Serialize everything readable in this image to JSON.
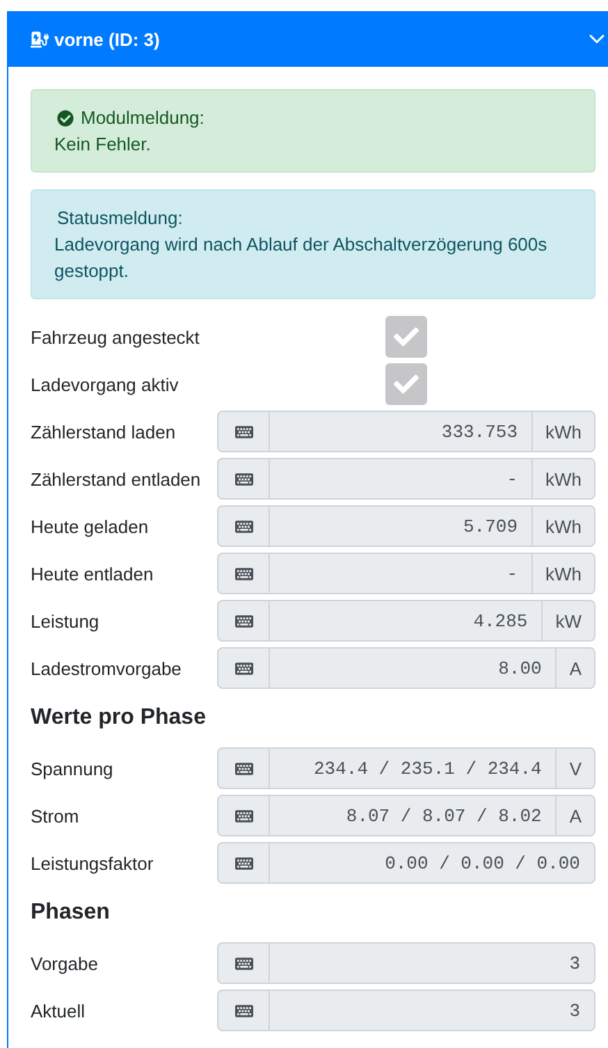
{
  "header": {
    "title": "vorne (ID: 3)",
    "expanded": true
  },
  "alerts": [
    {
      "kind": "success",
      "title": "Modulmeldung:",
      "text": "Kein Fehler."
    },
    {
      "kind": "info",
      "title": "Statusmeldung:",
      "text": "Ladevorgang wird nach Ablauf der Abschaltverzögerung 600s gestoppt."
    }
  ],
  "sections": [
    {
      "rows": [
        {
          "kind": "checkbox",
          "label": "Fahrzeug angesteckt",
          "checked": true
        },
        {
          "kind": "checkbox",
          "label": "Ladevorgang aktiv",
          "checked": true
        },
        {
          "kind": "readout",
          "label": "Zählerstand laden",
          "value": "333.753",
          "unit": "kWh"
        },
        {
          "kind": "readout",
          "label": "Zählerstand entladen",
          "value": "-",
          "unit": "kWh"
        },
        {
          "kind": "readout",
          "label": "Heute geladen",
          "value": "5.709",
          "unit": "kWh"
        },
        {
          "kind": "readout",
          "label": "Heute entladen",
          "value": "-",
          "unit": "kWh"
        },
        {
          "kind": "readout",
          "label": "Leistung",
          "value": "4.285",
          "unit": "kW"
        },
        {
          "kind": "readout",
          "label": "Ladestromvorgabe",
          "value": "8.00",
          "unit": "A"
        }
      ]
    },
    {
      "heading": "Werte pro Phase",
      "rows": [
        {
          "kind": "readout",
          "label": "Spannung",
          "value": "234.4 / 235.1 / 234.4",
          "unit": "V"
        },
        {
          "kind": "readout",
          "label": "Strom",
          "value": "8.07 / 8.07 / 8.02",
          "unit": "A"
        },
        {
          "kind": "readout",
          "label": "Leistungsfaktor",
          "value": "0.00 / 0.00 / 0.00"
        }
      ]
    },
    {
      "heading": "Phasen",
      "rows": [
        {
          "kind": "readout",
          "label": "Vorgabe",
          "value": "3"
        },
        {
          "kind": "readout",
          "label": "Aktuell",
          "value": "3"
        }
      ]
    }
  ]
}
